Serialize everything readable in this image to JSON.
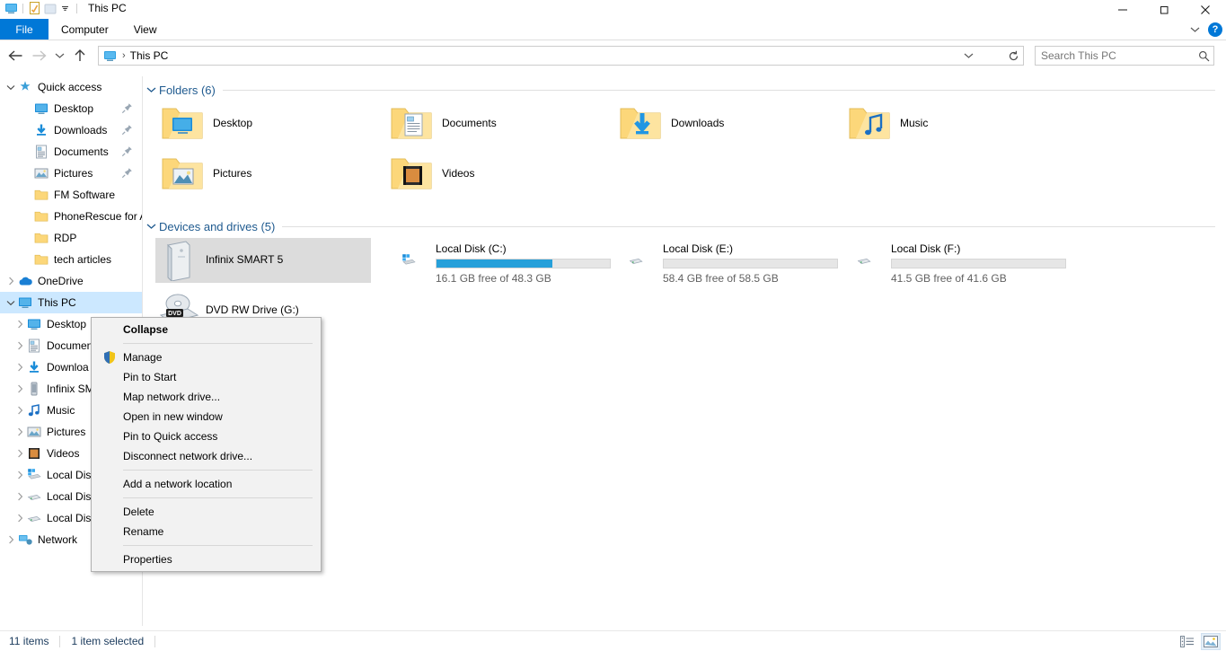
{
  "window": {
    "title": "This PC",
    "quick_access_icons": [
      "this-pc-icon",
      "properties-icon",
      "new-folder-icon",
      "customize-dropdown-icon"
    ],
    "controls": {
      "minimize": "minimize-icon",
      "maximize": "maximize-icon",
      "close": "close-icon"
    }
  },
  "ribbon": {
    "tabs": [
      {
        "label": "File",
        "active": true
      },
      {
        "label": "Computer",
        "active": false
      },
      {
        "label": "View",
        "active": false
      }
    ],
    "collapse_icon": "chevron-down-icon",
    "help_label": "?"
  },
  "addressbar": {
    "back_icon": "arrow-left-icon",
    "forward_icon": "arrow-right-icon",
    "recent_icon": "chevron-down-icon",
    "up_icon": "arrow-up-icon",
    "path_icon": "this-pc-icon",
    "path": "This PC",
    "dropdown_icon": "chevron-down-icon",
    "refresh_icon": "refresh-icon"
  },
  "search": {
    "placeholder": "Search This PC",
    "icon": "search-icon"
  },
  "navpane": {
    "items": [
      {
        "label": "Quick access",
        "icon": "star-pin-icon",
        "level": 0,
        "chevron": "expanded",
        "pinned": false,
        "selected": false
      },
      {
        "label": "Desktop",
        "icon": "desktop-icon",
        "level": 1,
        "chevron": "none",
        "pinned": true,
        "selected": false
      },
      {
        "label": "Downloads",
        "icon": "downloads-icon",
        "level": 1,
        "chevron": "none",
        "pinned": true,
        "selected": false
      },
      {
        "label": "Documents",
        "icon": "documents-icon",
        "level": 1,
        "chevron": "none",
        "pinned": true,
        "selected": false
      },
      {
        "label": "Pictures",
        "icon": "pictures-icon",
        "level": 1,
        "chevron": "none",
        "pinned": true,
        "selected": false
      },
      {
        "label": "FM Software",
        "icon": "folder-icon",
        "level": 1,
        "chevron": "none",
        "pinned": false,
        "selected": false
      },
      {
        "label": "PhoneRescue for An",
        "icon": "folder-icon",
        "level": 1,
        "chevron": "none",
        "pinned": false,
        "selected": false
      },
      {
        "label": "RDP",
        "icon": "folder-icon",
        "level": 1,
        "chevron": "none",
        "pinned": false,
        "selected": false
      },
      {
        "label": "tech articles",
        "icon": "folder-icon",
        "level": 1,
        "chevron": "none",
        "pinned": false,
        "selected": false
      },
      {
        "label": "OneDrive",
        "icon": "onedrive-icon",
        "level": 0,
        "chevron": "collapsed",
        "pinned": false,
        "selected": false
      },
      {
        "label": "This PC",
        "icon": "this-pc-icon",
        "level": 0,
        "chevron": "expanded",
        "pinned": false,
        "selected": true
      },
      {
        "label": "Desktop",
        "icon": "desktop-icon",
        "level": 2,
        "chevron": "collapsed",
        "pinned": false,
        "selected": false
      },
      {
        "label": "Documen",
        "icon": "documents-icon",
        "level": 2,
        "chevron": "collapsed",
        "pinned": false,
        "selected": false
      },
      {
        "label": "Downloa",
        "icon": "downloads-icon",
        "level": 2,
        "chevron": "collapsed",
        "pinned": false,
        "selected": false
      },
      {
        "label": "Infinix SM",
        "icon": "phone-icon",
        "level": 2,
        "chevron": "collapsed",
        "pinned": false,
        "selected": false
      },
      {
        "label": "Music",
        "icon": "music-icon",
        "level": 2,
        "chevron": "collapsed",
        "pinned": false,
        "selected": false
      },
      {
        "label": "Pictures",
        "icon": "pictures-icon",
        "level": 2,
        "chevron": "collapsed",
        "pinned": false,
        "selected": false
      },
      {
        "label": "Videos",
        "icon": "videos-icon",
        "level": 2,
        "chevron": "collapsed",
        "pinned": false,
        "selected": false
      },
      {
        "label": "Local Disk",
        "icon": "windows-drive-icon",
        "level": 2,
        "chevron": "collapsed",
        "pinned": false,
        "selected": false
      },
      {
        "label": "Local Disk",
        "icon": "drive-icon",
        "level": 2,
        "chevron": "collapsed",
        "pinned": false,
        "selected": false
      },
      {
        "label": "Local Disk",
        "icon": "drive-icon",
        "level": 2,
        "chevron": "collapsed",
        "pinned": false,
        "selected": false
      },
      {
        "label": "Network",
        "icon": "network-icon",
        "level": 0,
        "chevron": "collapsed",
        "pinned": false,
        "selected": false
      }
    ]
  },
  "content": {
    "folders_group": {
      "title": "Folders (6)",
      "chevron": "expanded",
      "items": [
        {
          "label": "Desktop",
          "icon": "folder-desktop-icon"
        },
        {
          "label": "Documents",
          "icon": "folder-documents-icon"
        },
        {
          "label": "Downloads",
          "icon": "folder-downloads-icon"
        },
        {
          "label": "Music",
          "icon": "folder-music-icon"
        },
        {
          "label": "Pictures",
          "icon": "folder-pictures-icon"
        },
        {
          "label": "Videos",
          "icon": "folder-videos-icon"
        }
      ]
    },
    "drives_group": {
      "title": "Devices and drives (5)",
      "chevron": "expanded",
      "items": [
        {
          "label": "Infinix SMART 5",
          "icon": "portable-device-icon",
          "has_bar": false,
          "sub": "",
          "selected": true,
          "fill_percent": 0
        },
        {
          "label": "Local Disk (C:)",
          "icon": "windows-drive-icon",
          "has_bar": true,
          "sub": "16.1 GB free of 48.3 GB",
          "selected": false,
          "fill_percent": 67
        },
        {
          "label": "Local Disk (E:)",
          "icon": "drive-icon",
          "has_bar": true,
          "sub": "58.4 GB free of 58.5 GB",
          "selected": false,
          "fill_percent": 0
        },
        {
          "label": "Local Disk (F:)",
          "icon": "drive-icon",
          "has_bar": true,
          "sub": "41.5 GB free of 41.6 GB",
          "selected": false,
          "fill_percent": 0
        },
        {
          "label": "DVD RW Drive (G:)",
          "icon": "dvd-drive-icon",
          "has_bar": false,
          "sub": "",
          "selected": false,
          "fill_percent": 0
        }
      ]
    }
  },
  "context_menu": {
    "items": [
      {
        "label": "Collapse",
        "bold": true,
        "icon": "",
        "sep_after": true
      },
      {
        "label": "Manage",
        "bold": false,
        "icon": "shield-icon",
        "sep_after": false
      },
      {
        "label": "Pin to Start",
        "bold": false,
        "icon": "",
        "sep_after": false
      },
      {
        "label": "Map network drive...",
        "bold": false,
        "icon": "",
        "sep_after": false
      },
      {
        "label": "Open in new window",
        "bold": false,
        "icon": "",
        "sep_after": false
      },
      {
        "label": "Pin to Quick access",
        "bold": false,
        "icon": "",
        "sep_after": false
      },
      {
        "label": "Disconnect network drive...",
        "bold": false,
        "icon": "",
        "sep_after": true
      },
      {
        "label": "Add a network location",
        "bold": false,
        "icon": "",
        "sep_after": true
      },
      {
        "label": "Delete",
        "bold": false,
        "icon": "",
        "sep_after": false
      },
      {
        "label": "Rename",
        "bold": false,
        "icon": "",
        "sep_after": true
      },
      {
        "label": "Properties",
        "bold": false,
        "icon": "",
        "sep_after": false
      }
    ]
  },
  "statusbar": {
    "item_count": "11 items",
    "selection": "1 item selected",
    "views": [
      {
        "name": "details-view-icon",
        "active": false
      },
      {
        "name": "large-icons-view-icon",
        "active": true
      }
    ]
  },
  "colors": {
    "accent": "#0078d7",
    "selection": "#cce8ff",
    "group_header": "#1f5a8f",
    "bar_fill": "#26a0da",
    "tile_selected": "#dcdcdc"
  }
}
